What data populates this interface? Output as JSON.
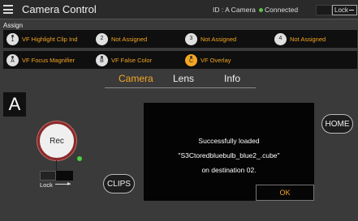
{
  "titlebar": {
    "menu_icon": "hamburger-menu-icon",
    "title": "Camera Control",
    "id": "ID : A Camera",
    "connection": "Connected",
    "connection_color": "#5ec24a",
    "lock": "Lock"
  },
  "assign": {
    "label": "Assign",
    "row1": [
      {
        "badge": "1",
        "label": "VF Highlight Clip Ind"
      },
      {
        "badge": "2",
        "label": "Not Assigned"
      },
      {
        "badge": "3",
        "label": "Not Assigned"
      },
      {
        "badge": "4",
        "label": "Not Assigned"
      }
    ],
    "row2": [
      {
        "badge": "A",
        "label": "VF Focus Magnifier"
      },
      {
        "badge": "B",
        "label": "VF False Color"
      },
      {
        "badge": "C",
        "label": "VF Overlay"
      }
    ]
  },
  "tabs": {
    "items": [
      "Camera",
      "Lens",
      "Info"
    ],
    "active": "Camera",
    "active_color": "#f4a623"
  },
  "camera_letter": "A",
  "controls": {
    "rec": "Rec",
    "lock": "Lock",
    "clips": "CLIPS",
    "home": "HOME",
    "status_color": "#4bd13f"
  },
  "dialog": {
    "line1": "Successfully loaded",
    "line2": "\"S3Ctoredbluebulb_blue2_.cube\"",
    "line3": "on destination 02.",
    "ok": "OK"
  },
  "colors": {
    "accent": "#f4a623",
    "background": "#3a3a3a",
    "rec_ring": "#8a2a2a"
  }
}
